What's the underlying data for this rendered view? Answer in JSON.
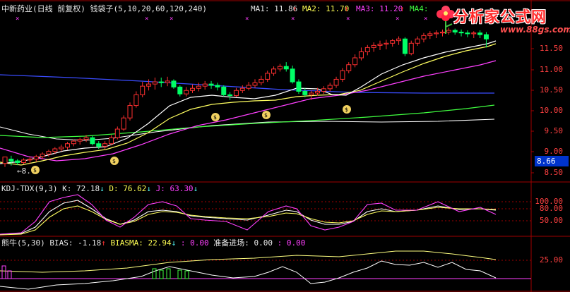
{
  "header": {
    "title": "中新药业(日线 前复权)",
    "indicator": "钱袋子",
    "params": "(5,10,20,60,120,240)",
    "ma1": "MA1: 11.86",
    "ma2": "MA2: 11.70",
    "ma3": "MA3: 11.20",
    "ma4": "MA4:"
  },
  "kdj": {
    "name": "KDJ-TDX(9,3)",
    "k": "K: 72.18",
    "d": "D: 76.62",
    "j": "J: 63.30"
  },
  "bias": {
    "name": "熊牛(5,30)",
    "bias": "BIAS: -1.18",
    "biasma": "BIASMA: 22.94",
    "v1": ": 0.00",
    "label": "准备进场: 0.00",
    "v2": ": 0.00"
  },
  "price_axis": [
    "11.50",
    "11.00",
    "10.50",
    "10.00",
    "9.50",
    "9.00",
    "8.50"
  ],
  "current_price": "8.66",
  "low_marker": "8.",
  "kdj_axis": [
    "100.00",
    "80.00",
    "50.00"
  ],
  "bias_axis": [
    "25.00"
  ],
  "logo": {
    "main": "分析家公式网",
    "url": "www.88gs.com"
  },
  "colors": {
    "up": "#ff3030",
    "down": "#00ff66",
    "ma_white": "#ffffff",
    "ma_yellow": "#ffff60",
    "ma_magenta": "#ff40ff",
    "ma_green": "#40ff40",
    "ma_blue": "#3050ff",
    "axis": "#a00000"
  },
  "chart_data": {
    "type": "candlestick",
    "candles": [
      [
        8.7,
        8.85,
        8.62,
        8.8
      ],
      [
        8.8,
        8.75,
        8.65,
        8.88
      ],
      [
        8.76,
        8.72,
        8.66,
        8.8
      ],
      [
        8.72,
        8.78,
        8.68,
        8.82
      ],
      [
        8.78,
        8.8,
        8.7,
        8.86
      ],
      [
        8.8,
        8.86,
        8.74,
        8.9
      ],
      [
        8.86,
        8.92,
        8.8,
        8.96
      ],
      [
        8.92,
        8.98,
        8.86,
        9.02
      ],
      [
        8.98,
        9.04,
        8.92,
        9.08
      ],
      [
        9.04,
        9.08,
        8.98,
        9.14
      ],
      [
        9.08,
        9.16,
        9.02,
        9.2
      ],
      [
        9.16,
        9.22,
        9.1,
        9.26
      ],
      [
        9.22,
        9.26,
        9.14,
        9.3
      ],
      [
        9.26,
        9.3,
        9.2,
        9.36
      ],
      [
        9.3,
        9.16,
        9.12,
        9.34
      ],
      [
        9.16,
        9.1,
        9.04,
        9.22
      ],
      [
        9.1,
        9.16,
        9.04,
        9.22
      ],
      [
        9.16,
        9.3,
        9.12,
        9.36
      ],
      [
        9.3,
        9.5,
        9.26,
        9.56
      ],
      [
        9.5,
        9.76,
        9.46,
        9.82
      ],
      [
        9.76,
        10.05,
        9.7,
        10.12
      ],
      [
        10.05,
        10.3,
        10.0,
        10.38
      ],
      [
        10.3,
        10.5,
        10.24,
        10.6
      ],
      [
        10.5,
        10.55,
        10.4,
        10.66
      ],
      [
        10.55,
        10.6,
        10.42,
        10.7
      ],
      [
        10.6,
        10.58,
        10.48,
        10.7
      ],
      [
        10.58,
        10.62,
        10.5,
        10.72
      ],
      [
        10.62,
        10.48,
        10.44,
        10.66
      ],
      [
        10.48,
        10.32,
        10.26,
        10.52
      ],
      [
        10.32,
        10.4,
        10.26,
        10.48
      ],
      [
        10.4,
        10.45,
        10.34,
        10.54
      ],
      [
        10.45,
        10.5,
        10.38,
        10.58
      ],
      [
        10.5,
        10.55,
        10.42,
        10.62
      ],
      [
        10.55,
        10.52,
        10.44,
        10.62
      ],
      [
        10.52,
        10.48,
        10.4,
        10.58
      ],
      [
        10.48,
        10.3,
        10.26,
        10.52
      ],
      [
        10.3,
        10.28,
        10.18,
        10.36
      ],
      [
        10.28,
        10.4,
        10.24,
        10.46
      ],
      [
        10.4,
        10.45,
        10.34,
        10.52
      ],
      [
        10.45,
        10.52,
        10.4,
        10.6
      ],
      [
        10.52,
        10.58,
        10.46,
        10.66
      ],
      [
        10.58,
        10.66,
        10.52,
        10.74
      ],
      [
        10.66,
        10.8,
        10.6,
        10.86
      ],
      [
        10.8,
        10.9,
        10.74,
        10.96
      ],
      [
        10.9,
        10.96,
        10.84,
        11.02
      ],
      [
        10.96,
        10.9,
        10.84,
        11.06
      ],
      [
        10.9,
        10.6,
        10.56,
        10.98
      ],
      [
        10.6,
        10.38,
        10.32,
        10.66
      ],
      [
        10.38,
        10.3,
        10.24,
        10.46
      ],
      [
        10.3,
        10.34,
        10.18,
        10.4
      ],
      [
        10.34,
        10.38,
        10.28,
        10.46
      ],
      [
        10.38,
        10.44,
        10.32,
        10.5
      ],
      [
        10.44,
        10.52,
        10.38,
        10.58
      ],
      [
        10.52,
        10.66,
        10.46,
        10.72
      ],
      [
        10.66,
        10.86,
        10.6,
        10.92
      ],
      [
        10.86,
        11.0,
        10.8,
        11.06
      ],
      [
        11.0,
        11.16,
        10.94,
        11.24
      ],
      [
        11.16,
        11.3,
        11.1,
        11.4
      ],
      [
        11.3,
        11.4,
        11.22,
        11.46
      ],
      [
        11.4,
        11.45,
        11.3,
        11.52
      ],
      [
        11.45,
        11.48,
        11.34,
        11.56
      ],
      [
        11.48,
        11.5,
        11.36,
        11.58
      ],
      [
        11.5,
        11.56,
        11.42,
        11.6
      ],
      [
        11.56,
        11.6,
        11.46,
        11.66
      ],
      [
        11.6,
        11.26,
        11.2,
        11.64
      ],
      [
        11.26,
        11.5,
        11.22,
        11.56
      ],
      [
        11.5,
        11.6,
        11.44,
        11.66
      ],
      [
        11.6,
        11.68,
        11.52,
        11.74
      ],
      [
        11.68,
        11.72,
        11.6,
        11.78
      ],
      [
        11.72,
        11.74,
        11.62,
        11.8
      ],
      [
        11.74,
        11.76,
        11.66,
        11.82
      ],
      [
        11.76,
        11.8,
        11.7,
        11.86
      ],
      [
        11.8,
        11.76,
        11.7,
        11.84
      ],
      [
        11.76,
        11.74,
        11.66,
        11.82
      ],
      [
        11.74,
        11.72,
        11.64,
        11.8
      ],
      [
        11.72,
        11.74,
        11.62,
        11.78
      ],
      [
        11.74,
        11.7,
        11.62,
        11.8
      ],
      [
        11.7,
        11.6,
        11.4,
        11.76
      ]
    ],
    "ylim": [
      8.4,
      11.85
    ]
  }
}
